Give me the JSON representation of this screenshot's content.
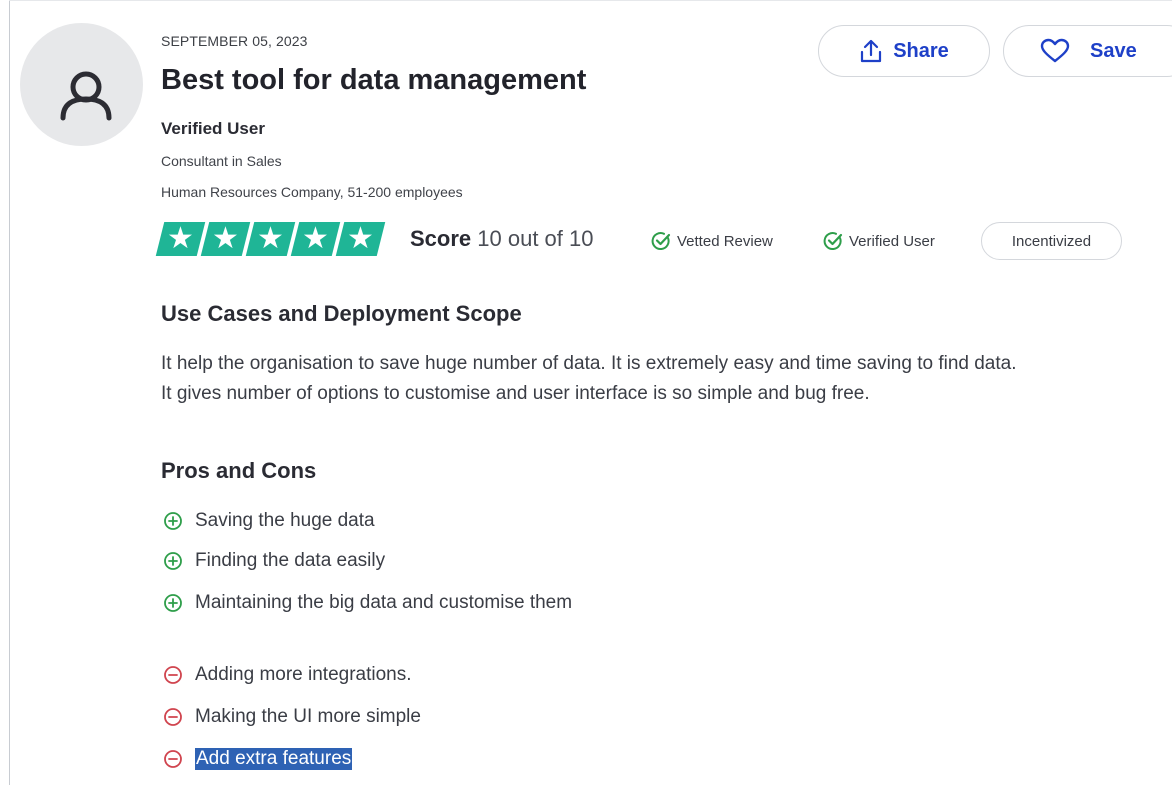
{
  "review": {
    "date": "SEPTEMBER 05, 2023",
    "title": "Best tool for data management",
    "reviewer": {
      "name": "Verified User",
      "role": "Consultant in Sales",
      "company": "Human Resources Company, 51-200 employees"
    },
    "rating": {
      "stars": 5,
      "max_stars": 5,
      "score_label": "Score",
      "score_text": "10 out of 10"
    },
    "badges": {
      "vetted": "Vetted Review",
      "verified": "Verified User",
      "incentivized": "Incentivized"
    }
  },
  "actions": {
    "share_label": "Share",
    "save_label": "Save"
  },
  "sections": {
    "use_cases": {
      "heading": "Use Cases and Deployment Scope",
      "line1": "It help the organisation to save huge number of data. It is extremely easy and time saving to find data.",
      "line2": "It gives number of options to customise and user interface is so simple and bug free."
    },
    "pros_cons": {
      "heading": "Pros and Cons",
      "pros": [
        "Saving the huge data",
        "Finding the data easily",
        "Maintaining the big data and customise them"
      ],
      "cons": [
        "Adding more integrations.",
        "Making the UI more simple",
        "Add extra features"
      ]
    }
  },
  "colors": {
    "accent": "#1e40c8",
    "star_green": "#1fb596",
    "pro_green": "#2e9e4a",
    "con_red": "#d0444e",
    "selection": "#2e62b4"
  },
  "icons": {
    "share": "share-icon",
    "save": "heart-icon",
    "badge_check": "check-circle-icon",
    "pro": "plus-circle-icon",
    "con": "minus-circle-icon"
  }
}
